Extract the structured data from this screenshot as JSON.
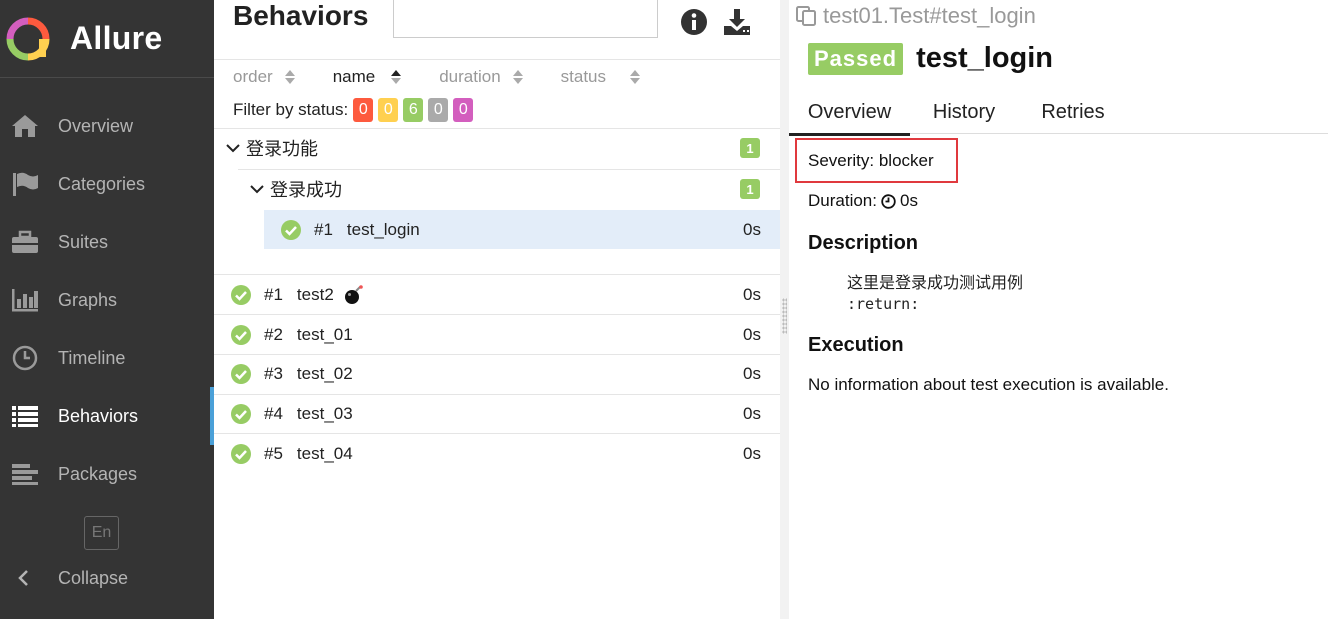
{
  "app": {
    "name": "Allure"
  },
  "sidebar": {
    "items": [
      {
        "label": "Overview",
        "icon": "home-icon",
        "active": false
      },
      {
        "label": "Categories",
        "icon": "flag-icon",
        "active": false
      },
      {
        "label": "Suites",
        "icon": "briefcase-icon",
        "active": false
      },
      {
        "label": "Graphs",
        "icon": "bar-chart-icon",
        "active": false
      },
      {
        "label": "Timeline",
        "icon": "clock-icon",
        "active": false
      },
      {
        "label": "Behaviors",
        "icon": "list-icon",
        "active": true
      },
      {
        "label": "Packages",
        "icon": "align-left-icon",
        "active": false
      }
    ],
    "language": "En",
    "collapse_label": "Collapse"
  },
  "tree": {
    "title": "Behaviors",
    "search_value": "",
    "sorters": [
      {
        "label": "order",
        "active": false
      },
      {
        "label": "name",
        "active": true
      },
      {
        "label": "duration",
        "active": false
      },
      {
        "label": "status",
        "active": false
      }
    ],
    "filter_label": "Filter by status:",
    "status_counts": {
      "failed": "0",
      "broken": "0",
      "passed": "6",
      "skipped": "0",
      "unknown": "0"
    },
    "feature": {
      "name": "登录功能",
      "count": "1"
    },
    "story": {
      "name": "登录成功",
      "count": "1"
    },
    "selected_leaf": {
      "num": "#1",
      "name": "test_login",
      "duration": "0s"
    },
    "leaves": [
      {
        "num": "#1",
        "name": "test2",
        "duration": "0s",
        "bomb": true
      },
      {
        "num": "#2",
        "name": "test_01",
        "duration": "0s",
        "bomb": false
      },
      {
        "num": "#3",
        "name": "test_02",
        "duration": "0s",
        "bomb": false
      },
      {
        "num": "#4",
        "name": "test_03",
        "duration": "0s",
        "bomb": false
      },
      {
        "num": "#5",
        "name": "test_04",
        "duration": "0s",
        "bomb": false
      }
    ]
  },
  "detail": {
    "breadcrumb": "test01.Test#test_login",
    "status": "Passed",
    "title": "test_login",
    "tabs": [
      "Overview",
      "History",
      "Retries"
    ],
    "severity": "Severity: blocker",
    "duration_label": "Duration:",
    "duration_value": "0s",
    "description_heading": "Description",
    "description_line1": "这里是登录成功测试用例",
    "description_line2": ":return:",
    "execution_heading": "Execution",
    "execution_text": "No information about test execution is available."
  },
  "colors": {
    "sidebar_bg": "#343434",
    "passed": "#97cc64",
    "failed": "#fd5a3e",
    "broken": "#ffd050",
    "skipped": "#aaaaaa",
    "unknown": "#d35ebe",
    "active_accent": "#4aa0d8",
    "highlight_border": "#e0393e"
  }
}
